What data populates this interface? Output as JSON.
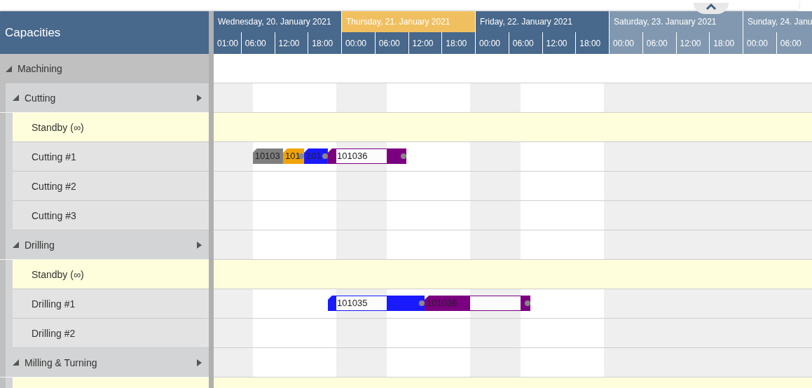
{
  "header": {
    "title": "Capacities"
  },
  "days": [
    {
      "label": "Wednesday, 20. January 2021",
      "kind": "weekday",
      "hours": [
        "01:00",
        "06:00",
        "12:00",
        "18:00"
      ]
    },
    {
      "label": "Thursday, 21. January 2021",
      "kind": "today",
      "hours": [
        "00:00",
        "06:00",
        "12:00",
        "18:00"
      ]
    },
    {
      "label": "Friday, 22. January 2021",
      "kind": "weekday",
      "hours": [
        "00:00",
        "06:00",
        "12:00",
        "18:00"
      ]
    },
    {
      "label": "Saturday, 23. January 2021",
      "kind": "weekend",
      "hours": [
        "00:00",
        "06:00",
        "12:00",
        "18:00"
      ]
    },
    {
      "label": "Sunday, 24. Janu",
      "kind": "weekend",
      "hours": [
        "00:00",
        "06:00"
      ]
    }
  ],
  "tree": [
    {
      "label": "Machining",
      "kind": "group",
      "expanded": true,
      "children": [
        {
          "label": "Cutting",
          "kind": "group",
          "expanded": true,
          "children": [
            {
              "label": "Standby (∞)",
              "kind": "standby"
            },
            {
              "label": "Cutting #1",
              "kind": "resource",
              "bars": [
                {
                  "label": "10103",
                  "color": "#7f7f7f",
                  "linked": false
                },
                {
                  "label": "101",
                  "color": "#f0a30a",
                  "linked": true
                },
                {
                  "label": "101",
                  "color": "#1a1aff",
                  "linked": true
                },
                {
                  "label": "101036",
                  "color": "#7a0080",
                  "linked": true
                }
              ]
            },
            {
              "label": "Cutting #2",
              "kind": "resource"
            },
            {
              "label": "Cutting #3",
              "kind": "resource"
            }
          ]
        },
        {
          "label": "Drilling",
          "kind": "group",
          "expanded": true,
          "children": [
            {
              "label": "Standby (∞)",
              "kind": "standby"
            },
            {
              "label": "Drilling #1",
              "kind": "resource",
              "bars": [
                {
                  "label": "101035",
                  "color": "#1a1aff",
                  "linked": true
                },
                {
                  "label": "101036",
                  "color": "#7a0080",
                  "linked": true
                }
              ]
            },
            {
              "label": "Drilling #2",
              "kind": "resource"
            }
          ]
        },
        {
          "label": "Milling & Turning",
          "kind": "group",
          "expanded": true,
          "children": [
            {
              "kind": "standby"
            }
          ]
        }
      ]
    }
  ]
}
